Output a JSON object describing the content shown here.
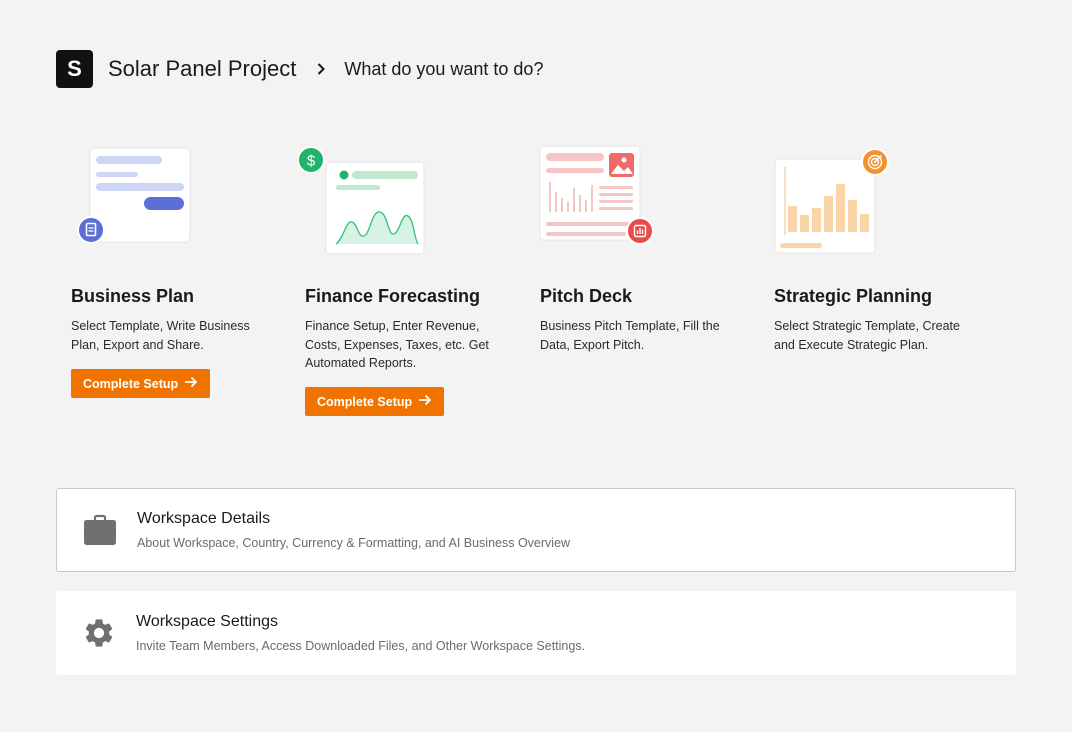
{
  "header": {
    "logo_letter": "S",
    "project_title": "Solar Panel Project",
    "breadcrumb_current": "What do you want to do?"
  },
  "cards": [
    {
      "title": "Business Plan",
      "description": "Select Template, Write Business Plan, Export and Share.",
      "button_label": "Complete Setup",
      "badge_icon": "document-icon",
      "badge_color": "#5b6fd6"
    },
    {
      "title": "Finance Forecasting",
      "description": "Finance Setup, Enter Revenue, Costs, Expenses, Taxes, etc. Get Automated Reports.",
      "button_label": "Complete Setup",
      "badge_icon": "dollar-icon",
      "badge_color": "#22b36a"
    },
    {
      "title": "Pitch Deck",
      "description": "Business Pitch Template, Fill the Data, Export Pitch.",
      "badge_icon": "chart-icon",
      "badge_color": "#e84d4d"
    },
    {
      "title": "Strategic Planning",
      "description": "Select Strategic Template, Create and Execute Strategic Plan.",
      "badge_icon": "target-icon",
      "badge_color": "#f2922b"
    }
  ],
  "panels": [
    {
      "title": "Workspace Details",
      "description": "About Workspace, Country, Currency & Formatting, and AI Business Overview",
      "icon": "briefcase-icon"
    },
    {
      "title": "Workspace Settings",
      "description": "Invite Team Members, Access Downloaded Files, and Other Workspace Settings.",
      "icon": "gear-icon"
    }
  ],
  "colors": {
    "accent": "#f07300",
    "background": "#f2f3f2"
  }
}
